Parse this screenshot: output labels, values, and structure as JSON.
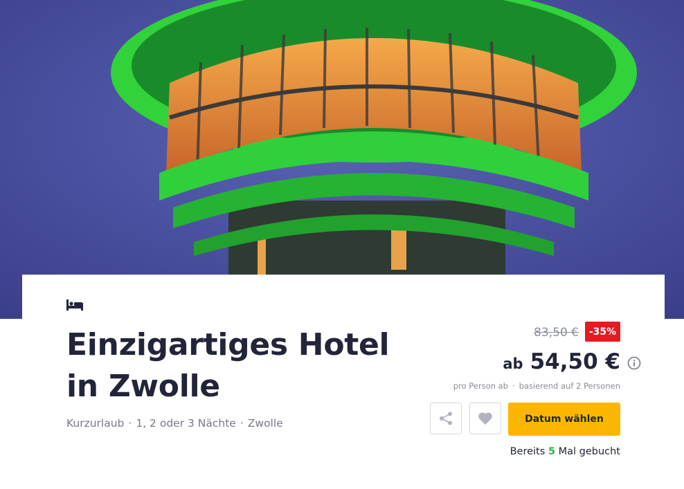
{
  "colors": {
    "discount_bg": "#e31b23",
    "cta_bg": "#fbb700",
    "booked_count": "#2cb34a",
    "title": "#22253a"
  },
  "hero": {
    "icon": "tower-photo"
  },
  "offer": {
    "type_icon": "bed-icon",
    "title": "Einzigartiges Hotel in Zwolle",
    "meta": [
      "Kurzurlaub",
      "1, 2 oder 3 Nächte",
      "Zwolle"
    ],
    "meta_separator": "·"
  },
  "pricing": {
    "old_price": "83,50 €",
    "discount": "-35%",
    "prefix": "ab",
    "price": "54,50 €",
    "note_per_person": "pro Person ab",
    "note_separator": "·",
    "note_basis": "basierend auf 2 Personen"
  },
  "actions": {
    "share_icon": "share-icon",
    "favorite_icon": "heart-icon",
    "date_button": "Datum wählen"
  },
  "booked": {
    "prefix": "Bereits",
    "count": "5",
    "suffix": "Mal gebucht"
  }
}
